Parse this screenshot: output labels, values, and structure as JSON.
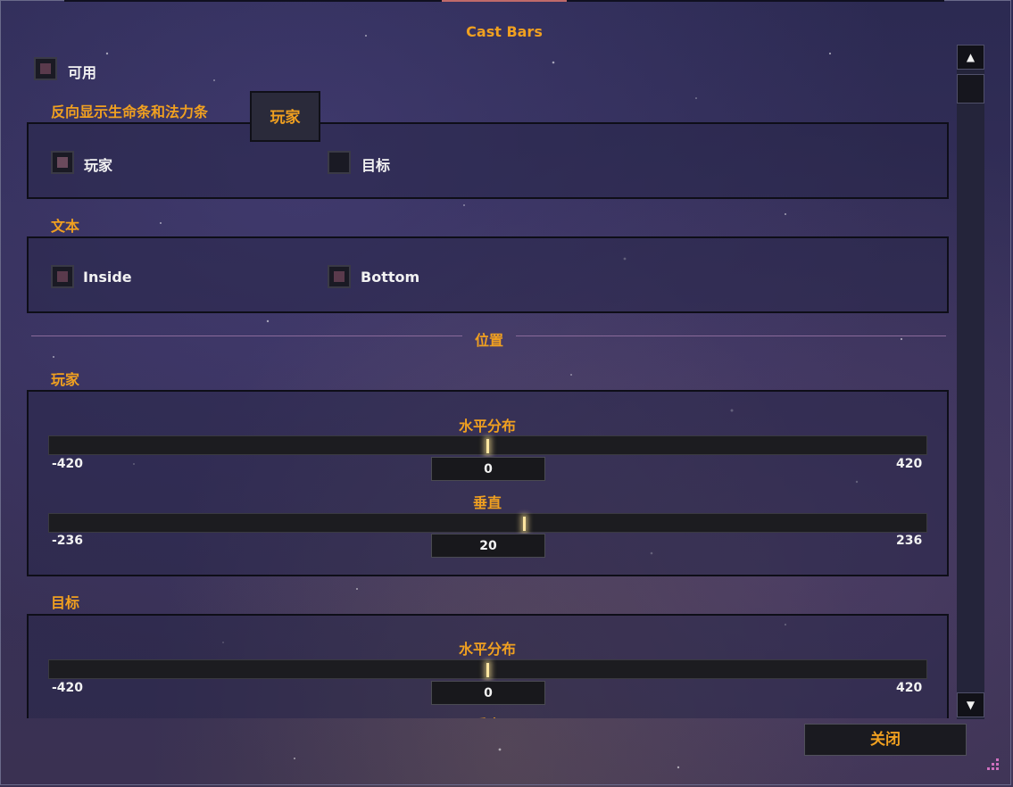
{
  "title": "Cast Bars",
  "enable_label": "可用",
  "reverse_section": {
    "label": "反向显示生命条和法力条",
    "tab_label": "玩家",
    "options": [
      "玩家",
      "目标"
    ]
  },
  "text_section": {
    "label": "文本",
    "options": [
      "Inside",
      "Bottom"
    ]
  },
  "position_divider": "位置",
  "player_section": {
    "label": "玩家",
    "horizontal": {
      "label": "水平分布",
      "min": "-420",
      "max": "420",
      "value": "0",
      "fraction": 0.5
    },
    "vertical": {
      "label": "垂直",
      "min": "-236",
      "max": "236",
      "value": "20",
      "fraction": 0.542
    }
  },
  "target_section": {
    "label": "目标",
    "horizontal": {
      "label": "水平分布",
      "min": "-420",
      "max": "420",
      "value": "0",
      "fraction": 0.5
    },
    "vertical_partial": "垂直"
  },
  "close_label": "关闭",
  "icons": {
    "scroll_up": "▲",
    "scroll_down": "▼"
  },
  "colors": {
    "accent": "#f0a020",
    "text": "#f2f2f2",
    "background": "#2c2a52"
  }
}
